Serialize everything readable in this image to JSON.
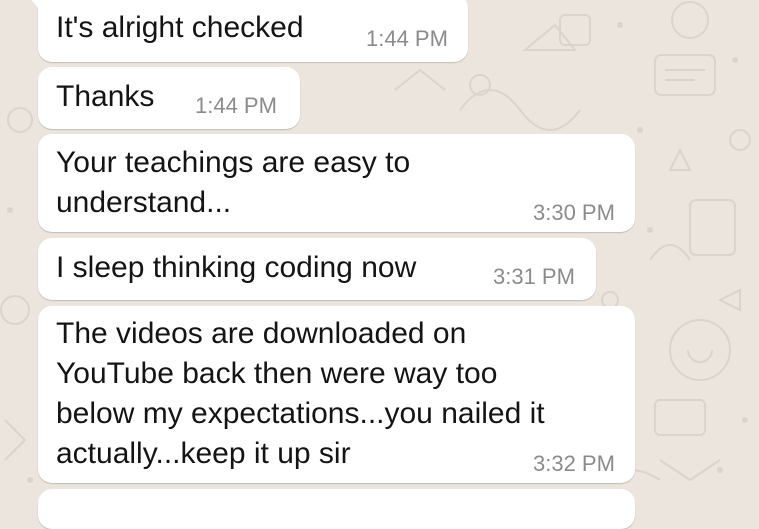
{
  "messages": [
    {
      "text": "It's alright checked",
      "time": "1:44 PM"
    },
    {
      "text": "Thanks",
      "time": "1:44 PM"
    },
    {
      "text": "Your teachings are easy to\nunderstand...",
      "time": "3:30 PM"
    },
    {
      "text": "I sleep thinking coding now",
      "time": "3:31 PM"
    },
    {
      "text": "The videos are downloaded on\nYouTube back then were way too\nbelow my expectations...you nailed it\nactually...keep it up sir",
      "time": "3:32 PM"
    }
  ],
  "colors": {
    "background": "#ece5dd",
    "bubble": "#ffffff",
    "text": "#141414",
    "timestamp": "#8b8b8b"
  }
}
